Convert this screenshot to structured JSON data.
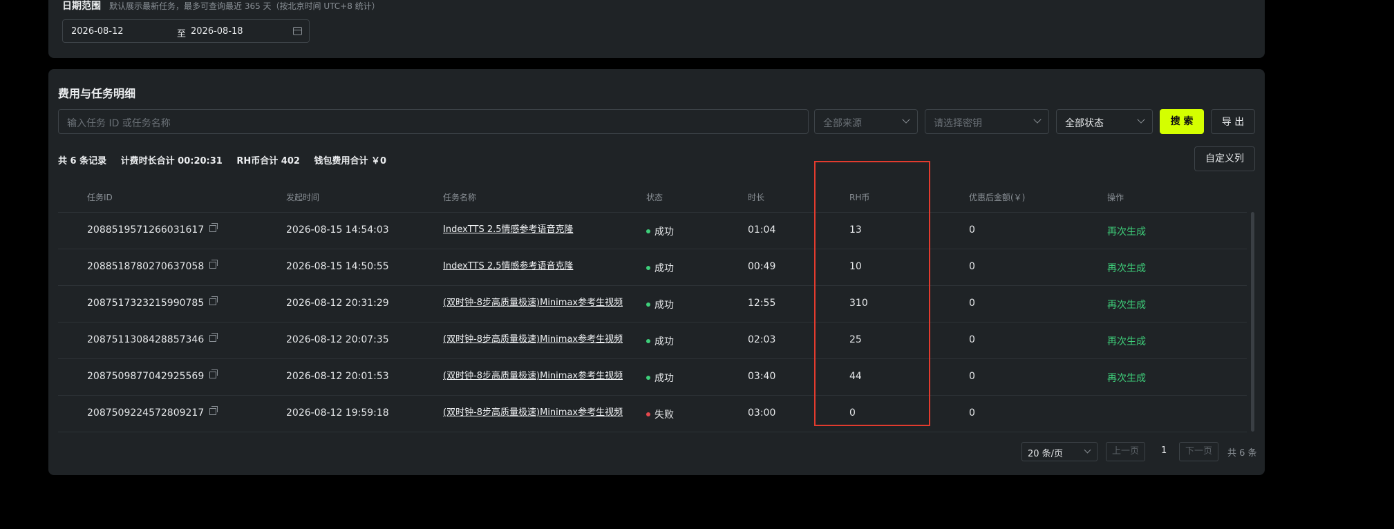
{
  "filter": {
    "title": "日期范围",
    "hint": "默认展示最新任务，最多可查询最近 365 天（按北京时间 UTC+8 统计）",
    "start_date": "2026-08-12",
    "separator": "至",
    "end_date": "2026-08-18"
  },
  "section": {
    "title": "费用与任务明细"
  },
  "toolbar": {
    "search_placeholder": "输入任务 ID 或任务名称",
    "source_select": "全部来源",
    "key_select": "请选择密钥",
    "status_select": "全部状态",
    "search_label": "搜 索",
    "export_label": "导 出"
  },
  "summary": {
    "records": "共 6 条记录",
    "duration": "计费时长合计 00:20:31",
    "rh_total": "RH币合计 402",
    "wallet": "钱包费用合计 ￥0"
  },
  "custom_columns_label": "自定义列",
  "table": {
    "columns": [
      "任务ID",
      "发起时间",
      "任务名称",
      "状态",
      "时长",
      "RH币",
      "优惠后金额(￥)",
      "操作"
    ],
    "rows": [
      {
        "id": "2088519571266031617",
        "time": "2026-08-15 14:54:03",
        "name": "IndexTTS 2.5情感参考语音克隆",
        "status": "成功",
        "status_color": "#3ecf7a",
        "duration": "01:04",
        "rh": "13",
        "amount": "0",
        "action": "再次生成"
      },
      {
        "id": "2088518780270637058",
        "time": "2026-08-15 14:50:55",
        "name": "IndexTTS 2.5情感参考语音克隆",
        "status": "成功",
        "status_color": "#3ecf7a",
        "duration": "00:49",
        "rh": "10",
        "amount": "0",
        "action": "再次生成"
      },
      {
        "id": "2087517323215990785",
        "time": "2026-08-12 20:31:29",
        "name": "(双时钟-8步高质量极速)Minimax参考生视频",
        "status": "成功",
        "status_color": "#3ecf7a",
        "duration": "12:55",
        "rh": "310",
        "amount": "0",
        "action": "再次生成"
      },
      {
        "id": "2087511308428857346",
        "time": "2026-08-12 20:07:35",
        "name": "(双时钟-8步高质量极速)Minimax参考生视频",
        "status": "成功",
        "status_color": "#3ecf7a",
        "duration": "02:03",
        "rh": "25",
        "amount": "0",
        "action": "再次生成"
      },
      {
        "id": "2087509877042925569",
        "time": "2026-08-12 20:01:53",
        "name": "(双时钟-8步高质量极速)Minimax参考生视频",
        "status": "成功",
        "status_color": "#3ecf7a",
        "duration": "03:40",
        "rh": "44",
        "amount": "0",
        "action": "再次生成"
      },
      {
        "id": "2087509224572809217",
        "time": "2026-08-12 19:59:18",
        "name": "(双时钟-8步高质量极速)Minimax参考生视频",
        "status": "失败",
        "status_color": "#e5484d",
        "duration": "03:00",
        "rh": "0",
        "amount": "0",
        "action": ""
      }
    ]
  },
  "pagination": {
    "page_size": "20 条/页",
    "prev": "上一页",
    "current": "1",
    "next": "下一页",
    "total": "共 6 条"
  },
  "colors": {
    "accent": "#d4ff00",
    "success": "#3ecf7a",
    "fail": "#e5484d",
    "highlight": "#e23b2e"
  }
}
